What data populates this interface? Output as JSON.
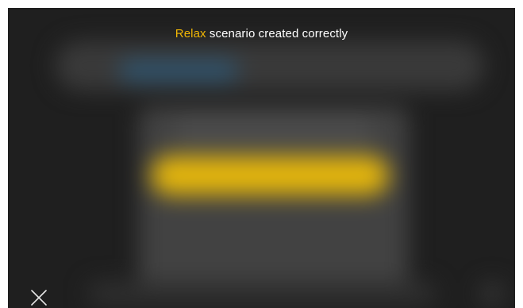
{
  "toast": {
    "highlight": "Relax",
    "message": " scenario created correctly",
    "highlight_color": "#f2b705"
  },
  "close": {
    "icon": "close-icon"
  }
}
